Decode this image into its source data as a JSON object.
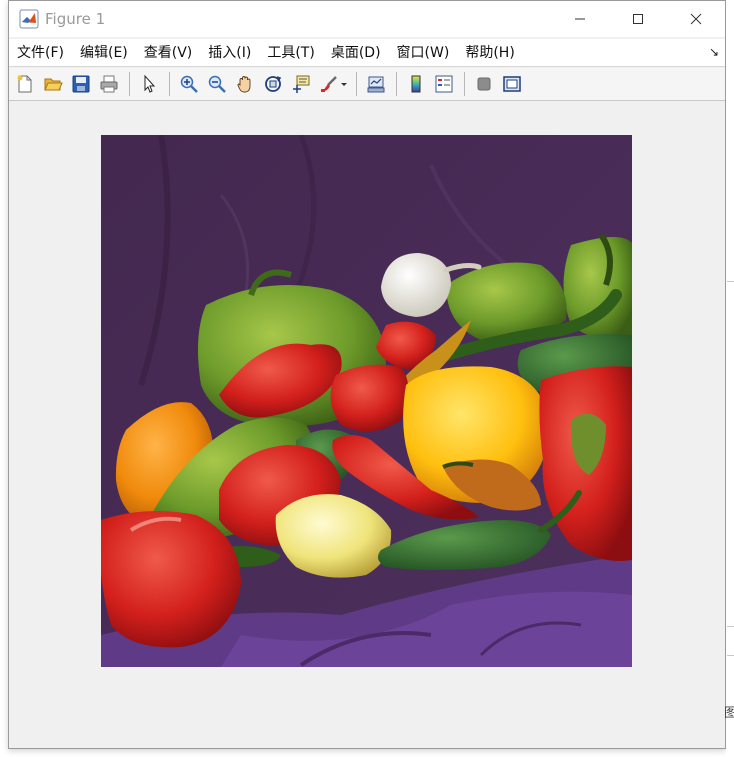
{
  "window": {
    "title": "Figure 1"
  },
  "menubar": {
    "items": [
      {
        "label": "文件(F)",
        "name": "menu-file"
      },
      {
        "label": "编辑(E)",
        "name": "menu-edit"
      },
      {
        "label": "查看(V)",
        "name": "menu-view"
      },
      {
        "label": "插入(I)",
        "name": "menu-insert"
      },
      {
        "label": "工具(T)",
        "name": "menu-tools"
      },
      {
        "label": "桌面(D)",
        "name": "menu-desktop"
      },
      {
        "label": "窗口(W)",
        "name": "menu-window"
      },
      {
        "label": "帮助(H)",
        "name": "menu-help"
      }
    ],
    "dock_glyph": "↘"
  },
  "toolbar": {
    "icons": [
      "new-figure-icon",
      "open-file-icon",
      "save-icon",
      "print-icon",
      "pointer-icon",
      "zoom-in-icon",
      "zoom-out-icon",
      "pan-hand-icon",
      "rotate-3d-icon",
      "data-cursor-icon",
      "brush-icon",
      "link-plot-icon",
      "colorbar-icon",
      "legend-icon",
      "hide-plot-tools-icon",
      "show-plot-tools-icon"
    ]
  },
  "figure": {
    "content": "displayed image of bell peppers on purple cloth"
  },
  "edge_glyph": "图"
}
